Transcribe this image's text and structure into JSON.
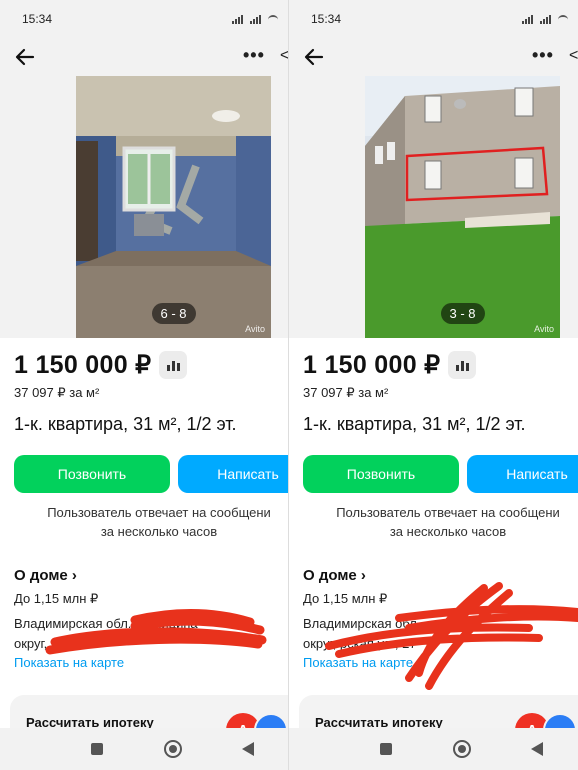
{
  "panels": [
    {
      "time": "15:34",
      "photo_counter": "6 - 8",
      "watermark": "Avito",
      "price": "1 150 000 ₽",
      "price_per_m2": "37 097 ₽ за м²",
      "title": "1-к. квартира, 31 м², 1/2 эт.",
      "call_label": "Позвонить",
      "write_label": "Написать",
      "reply_line1": "Пользователь отвечает на сообщени",
      "reply_line2": "за несколько часов",
      "about_label": "О доме ›",
      "near_label": "До 1,15 млн ₽",
      "address_line1": "Владимирская обл.,                муниципа",
      "address_line2": "округ,          Пол                     , 7",
      "map_link": "Показать на карте",
      "mortgage_label": "Рассчитать ипотеку",
      "bank_letter": "А"
    },
    {
      "time": "15:34",
      "photo_counter": "3 - 8",
      "watermark": "Avito",
      "price": "1 150 000 ₽",
      "price_per_m2": "37 097 ₽ за м²",
      "title": "1-к. квартира, 31 м², 1/2 эт.",
      "call_label": "Позвонить",
      "write_label": "Написать",
      "reply_line1": "Пользователь отвечает на сообщени",
      "reply_line2": "за несколько часов",
      "about_label": "О доме ›",
      "near_label": "До 1,15 млн ₽",
      "address_line1": "Владимирская обл.",
      "address_line2": "округ,                        рская ул., 27",
      "map_link": "Показать на карте",
      "mortgage_label": "Рассчитать ипотеку",
      "bank_letter": "А"
    }
  ],
  "colors": {
    "call_button": "#02d15c",
    "write_button": "#00aaff",
    "link": "#009cf0",
    "redaction": "#e8321c"
  },
  "icons": [
    "back-arrow-icon",
    "more-icon",
    "share-icon",
    "stats-icon",
    "nav-recent-icon",
    "nav-home-icon",
    "nav-back-icon"
  ]
}
